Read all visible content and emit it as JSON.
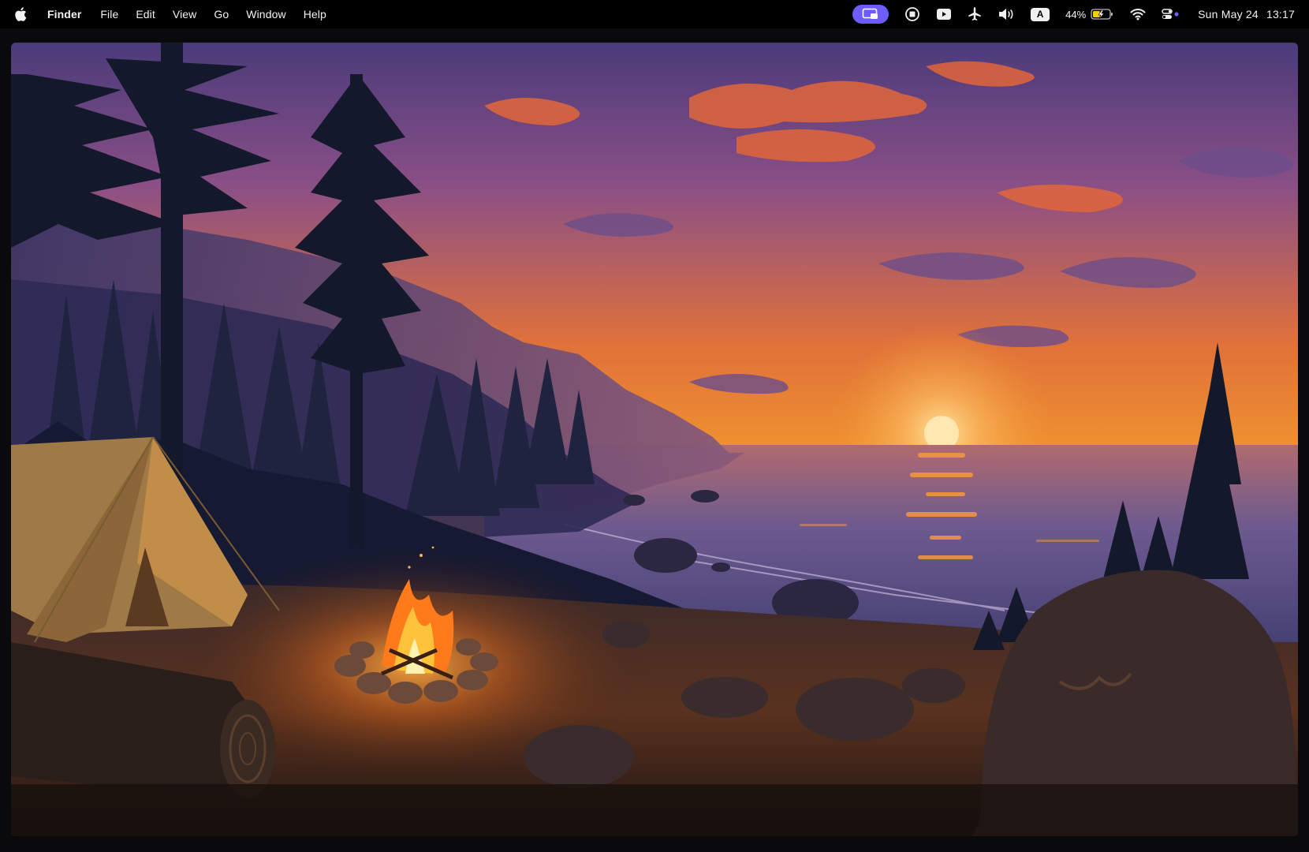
{
  "menubar": {
    "app_name": "Finder",
    "menus": [
      "File",
      "Edit",
      "View",
      "Go",
      "Window",
      "Help"
    ],
    "status_icons": [
      "screen-share-icon",
      "record-icon",
      "video-icon",
      "flight-icon",
      "volume-icon",
      "input-source-icon",
      "battery-icon",
      "wifi-icon",
      "control-center-icon"
    ],
    "input_source_label": "A",
    "battery_percent": "44%",
    "battery_level": 0.44,
    "clock_date": "Sun May 24",
    "clock_time": "13:17",
    "accent_color": "#6d5cff"
  },
  "wallpaper": {
    "description_icon": "campsite-sunset-wallpaper"
  }
}
